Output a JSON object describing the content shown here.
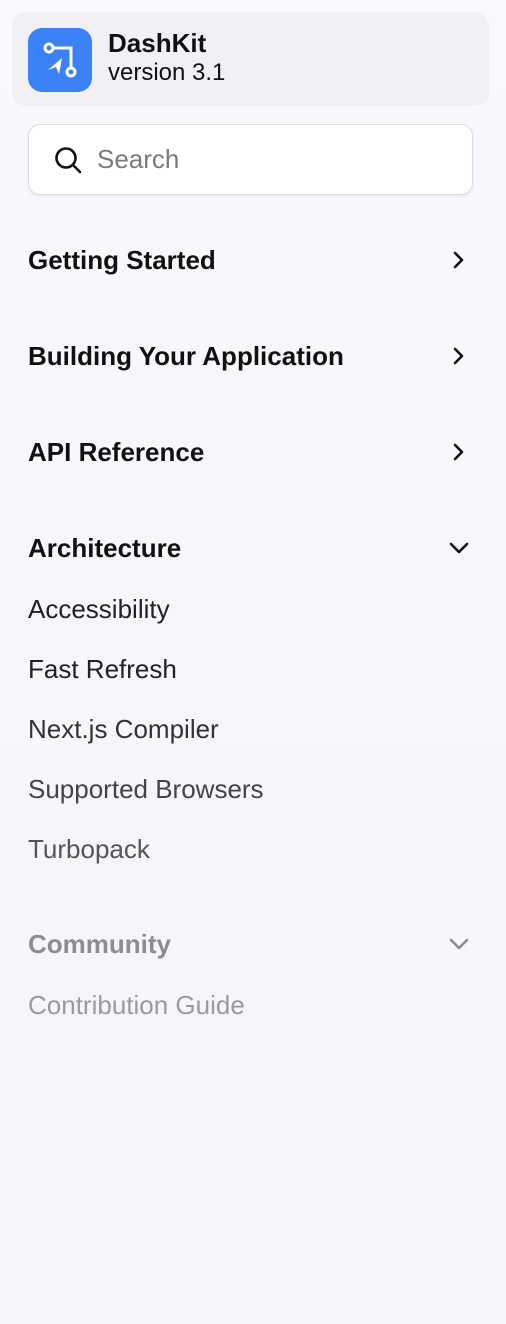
{
  "brand": {
    "name": "DashKit",
    "version": "version 3.1",
    "logo_icon": "route-navigation-icon",
    "accent_color": "#3b82f6"
  },
  "search": {
    "placeholder": "Search",
    "value": ""
  },
  "nav": {
    "sections": [
      {
        "label": "Getting Started",
        "state": "collapsed"
      },
      {
        "label": "Building Your Application",
        "state": "collapsed"
      },
      {
        "label": "API Reference",
        "state": "collapsed"
      },
      {
        "label": "Architecture",
        "state": "expanded",
        "items": [
          "Accessibility",
          "Fast Refresh",
          "Next.js Compiler",
          "Supported Browsers",
          "Turbopack"
        ]
      },
      {
        "label": "Community",
        "state": "expanded",
        "items": [
          "Contribution Guide"
        ]
      }
    ]
  }
}
